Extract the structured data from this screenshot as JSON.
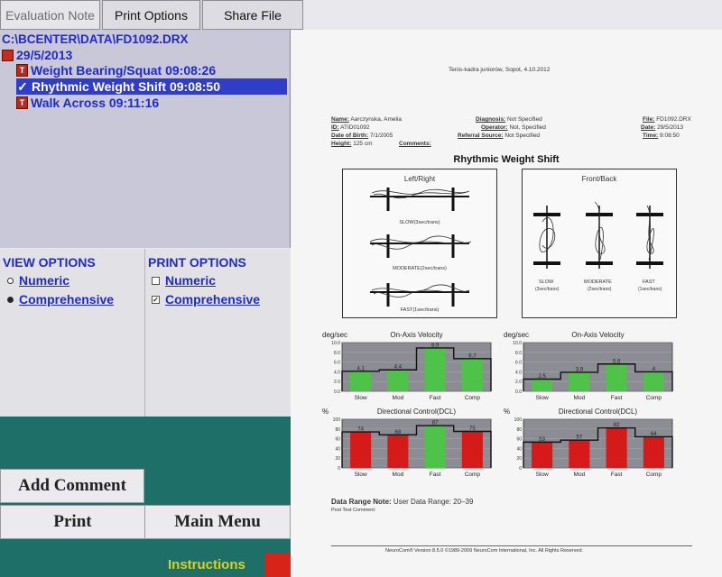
{
  "tabs": [
    "Evaluation Note",
    "Print Options",
    "Share File"
  ],
  "tree": {
    "path": "C:\\BCENTER\\DATA\\FD1092.DRX",
    "date": "29/5/2013",
    "items": [
      {
        "label": "Weight Bearing/Squat 09:08:26",
        "selected": false
      },
      {
        "label": "Rhythmic Weight Shift 09:08:50",
        "selected": true
      },
      {
        "label": "Walk Across 09:11:16",
        "selected": false
      }
    ]
  },
  "view_options": {
    "title": "VIEW OPTIONS",
    "numeric": "Numeric",
    "comprehensive": "Comprehensive",
    "selected": "Comprehensive"
  },
  "print_options": {
    "title": "PRINT OPTIONS",
    "numeric": "Numeric",
    "comprehensive": "Comprehensive",
    "numeric_checked": false,
    "comprehensive_checked": true
  },
  "buttons": {
    "add_comment": "Add Comment",
    "print": "Print",
    "main_menu": "Main Menu",
    "instructions": "Instructions"
  },
  "report": {
    "header": "Tenis-kadra juniorów, Sopot, 4.10.2012",
    "patient": {
      "name_label": "Name:",
      "name": "Aarczynska, Amelia",
      "id_label": "ID:",
      "id": "ATID01092",
      "dob_label": "Date of Birth:",
      "dob": "7/1/2005",
      "height_label": "Height:",
      "height": "125 cm",
      "comments_label": "Comments:",
      "diagnosis_label": "Diagnosis:",
      "diagnosis": "Not Specified",
      "operator_label": "Operator:",
      "operator": "Not, Specified",
      "referral_label": "Referral Source:",
      "referral": "Not Specified",
      "file_label": "File:",
      "file": "FD1092.DRX",
      "date_label": "Date:",
      "date": "29/5/2013",
      "time_label": "Time:",
      "time": "9:08:50"
    },
    "title": "Rhythmic Weight Shift",
    "left_right": {
      "title": "Left/Right",
      "slow": "SLOW(3sec/trans)",
      "moderate": "MODERATE(2sec/trans)",
      "fast": "FAST(1sec/trans)"
    },
    "front_back": {
      "title": "Front/Back",
      "slow": "SLOW",
      "slow_sub": "(3sec/trans)",
      "moderate": "MODERATE",
      "moderate_sub": "(2sec/trans)",
      "fast": "FAST",
      "fast_sub": "(1sec/trans)"
    },
    "data_range_label": "Data Range Note:",
    "data_range": "User Data Range: 20–39",
    "post_test": "Post Test Comment:",
    "footer": "NeuroCom® Version 8.5.0   ©1989-2009 NeuroCom International, Inc. All Rights Reserved."
  },
  "chart_data": [
    {
      "type": "bar",
      "title": "On-Axis Velocity",
      "ylabel": "deg/sec",
      "categories": [
        "Slow",
        "Mod",
        "Fast",
        "Comp"
      ],
      "values": [
        4.1,
        4.4,
        8.9,
        6.7
      ],
      "ylim": [
        0,
        10
      ],
      "yticks": [
        "10.0",
        "8.0",
        "6.0",
        "4.0",
        "2.0",
        "0.0"
      ],
      "bar_color": "#4fc24a"
    },
    {
      "type": "bar",
      "title": "On-Axis Velocity",
      "ylabel": "deg/sec",
      "categories": [
        "Slow",
        "Mod",
        "Fast",
        "Comp"
      ],
      "values": [
        2.5,
        3.9,
        5.6,
        4
      ],
      "ylim": [
        0,
        10
      ],
      "yticks": [
        "10.0",
        "8.0",
        "6.0",
        "4.0",
        "2.0",
        "0.0"
      ],
      "bar_color": "#4fc24a"
    },
    {
      "type": "bar",
      "title": "Directional Control(DCL)",
      "ylabel": "%",
      "categories": [
        "Slow",
        "Mod",
        "Fast",
        "Comp"
      ],
      "values": [
        74,
        68,
        87,
        75
      ],
      "ylim": [
        0,
        100
      ],
      "yticks": [
        "100",
        "80",
        "60",
        "40",
        "20",
        "0"
      ],
      "bar_colors": [
        "#d61a1a",
        "#d61a1a",
        "#4fc24a",
        "#d61a1a"
      ]
    },
    {
      "type": "bar",
      "title": "Directional Control(DCL)",
      "ylabel": "%",
      "categories": [
        "Slow",
        "Mod",
        "Fast",
        "Comp"
      ],
      "values": [
        53,
        57,
        82,
        64
      ],
      "ylim": [
        0,
        100
      ],
      "yticks": [
        "100",
        "80",
        "60",
        "40",
        "20",
        "0"
      ],
      "bar_colors": [
        "#d61a1a",
        "#d61a1a",
        "#d61a1a",
        "#d61a1a"
      ]
    }
  ]
}
